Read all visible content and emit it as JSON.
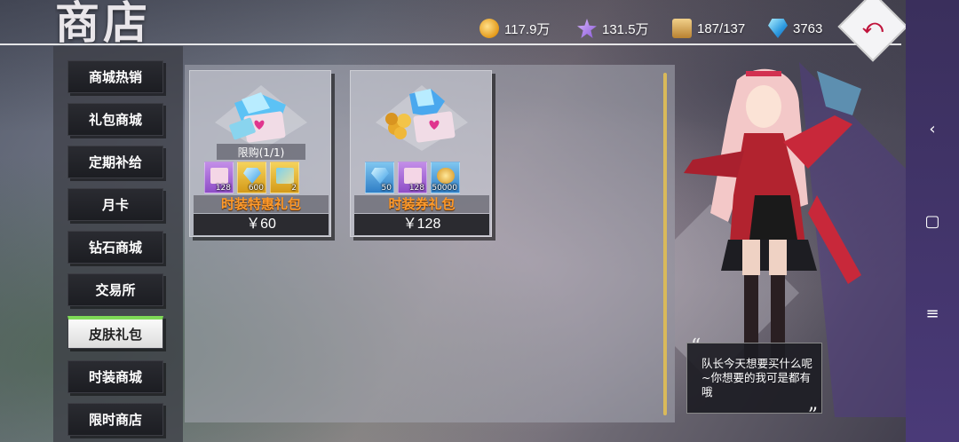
{
  "title": "商店",
  "currencies": [
    {
      "icon": "coin-icon",
      "value": "117.9万"
    },
    {
      "icon": "star-icon",
      "value": "131.5万"
    },
    {
      "icon": "box-icon",
      "value": "187/137"
    },
    {
      "icon": "gem-icon",
      "value": "3763"
    }
  ],
  "back_button": {
    "icon": "back-arrow-icon",
    "glyph": "⤺"
  },
  "menu": [
    {
      "label": "商城热销",
      "active": false
    },
    {
      "label": "礼包商城",
      "active": false
    },
    {
      "label": "定期补给",
      "active": false
    },
    {
      "label": "月卡",
      "active": false
    },
    {
      "label": "钻石商城",
      "active": false
    },
    {
      "label": "交易所",
      "active": false
    },
    {
      "label": "皮肤礼包",
      "active": true
    },
    {
      "label": "时装商城",
      "active": false
    },
    {
      "label": "限时商店",
      "active": false
    }
  ],
  "cards": [
    {
      "limit": "限购(1/1)",
      "items": [
        {
          "kind": "pink-ticket",
          "qty": "128"
        },
        {
          "kind": "blue-gem",
          "qty": "600"
        },
        {
          "kind": "gold-ticket",
          "qty": "2"
        }
      ],
      "name": "时装特惠礼包",
      "price": "￥60"
    },
    {
      "limit": "",
      "items": [
        {
          "kind": "blue-gem",
          "qty": "50"
        },
        {
          "kind": "pink-ticket",
          "qty": "128"
        },
        {
          "kind": "gold-coins",
          "qty": "50000"
        }
      ],
      "name": "时装券礼包",
      "price": "￥128"
    }
  ],
  "speech": "队长今天想要买什么呢~你想要的我可是都有哦",
  "quote_open": "“",
  "quote_close": "”",
  "nav": {
    "back": "‹",
    "home": "▢",
    "menu": "≡"
  },
  "colors": {
    "accent_gold": "#d9b95a",
    "card_name": "#ff9a2a",
    "active_tab": "#7ed957",
    "nav_purple": "#4a3a78"
  }
}
